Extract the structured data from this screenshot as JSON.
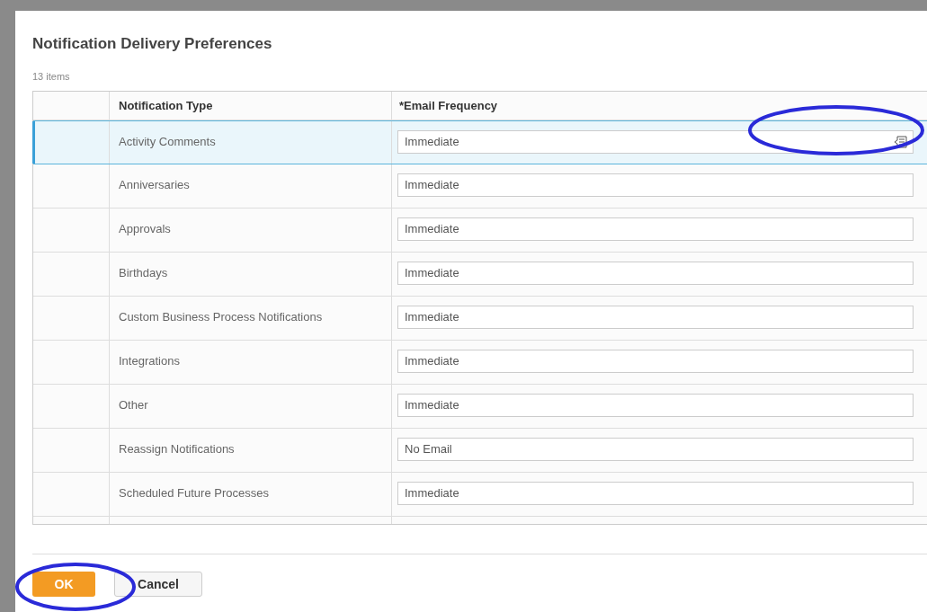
{
  "dialog": {
    "title": "Notification Delivery Preferences",
    "item_count": "13 items"
  },
  "table": {
    "columns": [
      "Notification Type",
      "*Email Frequency"
    ],
    "rows": [
      {
        "type": "Activity Comments",
        "frequency": "Immediate",
        "selected": true
      },
      {
        "type": "Anniversaries",
        "frequency": "Immediate",
        "selected": false
      },
      {
        "type": "Approvals",
        "frequency": "Immediate",
        "selected": false
      },
      {
        "type": "Birthdays",
        "frequency": "Immediate",
        "selected": false
      },
      {
        "type": "Custom Business Process Notifications",
        "frequency": "Immediate",
        "selected": false
      },
      {
        "type": "Integrations",
        "frequency": "Immediate",
        "selected": false
      },
      {
        "type": "Other",
        "frequency": "Immediate",
        "selected": false
      },
      {
        "type": "Reassign Notifications",
        "frequency": "No Email",
        "selected": false
      },
      {
        "type": "Scheduled Future Processes",
        "frequency": "Immediate",
        "selected": false
      }
    ]
  },
  "buttons": [
    {
      "label": "OK",
      "kind": "primary"
    },
    {
      "label": "Cancel",
      "kind": "secondary"
    }
  ]
}
